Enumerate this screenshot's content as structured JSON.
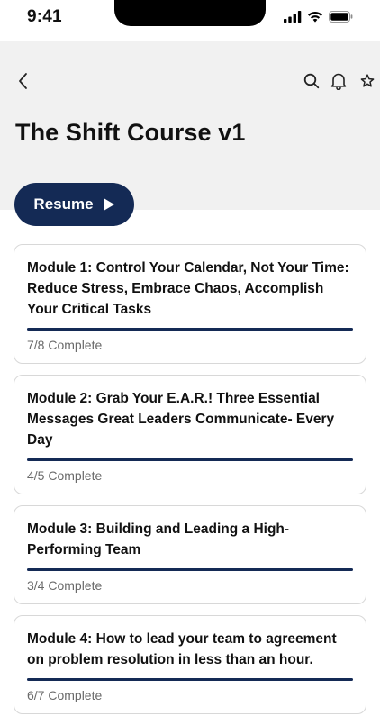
{
  "status_bar": {
    "time": "9:41",
    "icons": [
      "signal-icon",
      "wifi-icon",
      "battery-icon"
    ]
  },
  "header": {
    "title": "The Shift Course v1",
    "icons": [
      "back-chevron-icon",
      "search-icon",
      "bell-icon",
      "star-icon"
    ]
  },
  "resume": {
    "label": "Resume",
    "icon": "play-icon"
  },
  "colors": {
    "accent": "#142a55",
    "header_bg": "#f1f1f1",
    "card_border": "#d8d8d8",
    "muted_text": "#6a6a6a"
  },
  "modules": [
    {
      "title": "Module 1: Control Your Calendar, Not Your Time: Reduce Stress, Embrace Chaos, Accomplish Your Critical Tasks",
      "status": "7/8 Complete",
      "progress": 1.0
    },
    {
      "title": "Module 2: Grab Your E.A.R.! Three Essential Messages Great Leaders Communicate- Every Day",
      "status": "4/5 Complete",
      "progress": 1.0
    },
    {
      "title": "Module 3: Building and Leading a High-Performing Team",
      "status": "3/4 Complete",
      "progress": 1.0
    },
    {
      "title": "Module 4: How to lead your team to agreement on problem resolution in less than an hour.",
      "status": "6/7 Complete",
      "progress": 1.0
    }
  ]
}
